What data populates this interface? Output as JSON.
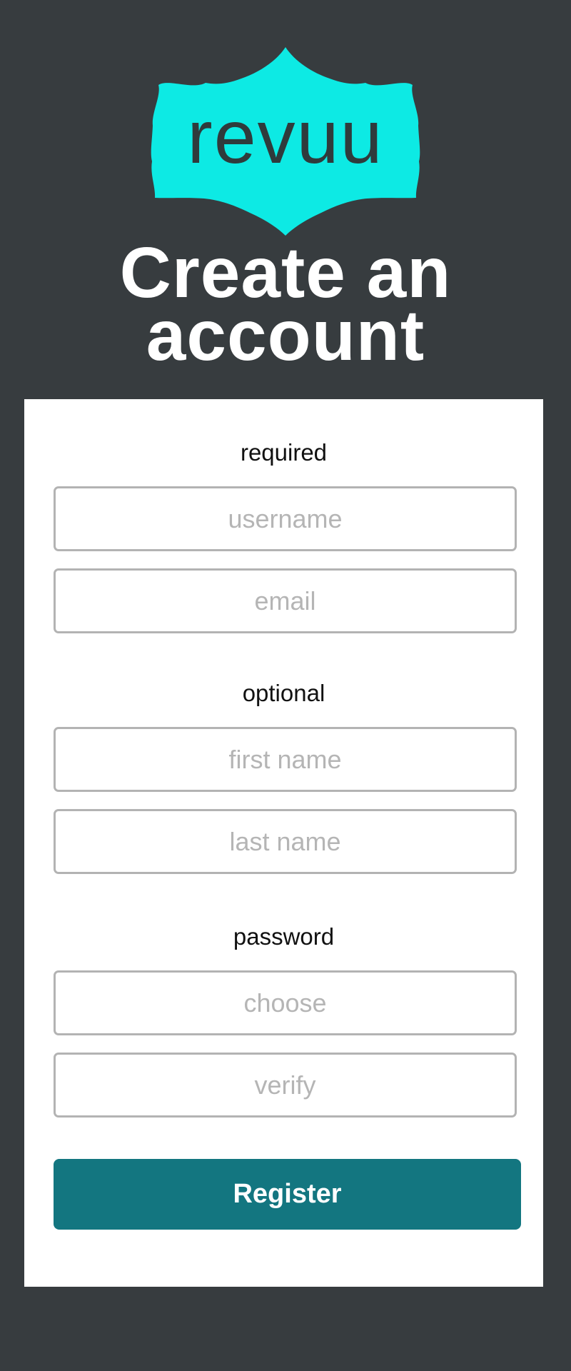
{
  "brand": {
    "logo_text": "revuu",
    "logo_color": "#0deae4",
    "logo_text_color": "#2f3b3c"
  },
  "page": {
    "title_line1": "Create an",
    "title_line2": "account",
    "background_color": "#373c3f"
  },
  "form": {
    "required_label": "required",
    "username_placeholder": "username",
    "email_placeholder": "email",
    "optional_label": "optional",
    "first_name_placeholder": "first name",
    "last_name_placeholder": "last name",
    "password_label": "password",
    "password_choose_placeholder": "choose",
    "password_verify_placeholder": "verify",
    "register_label": "Register",
    "register_color": "#137680"
  }
}
